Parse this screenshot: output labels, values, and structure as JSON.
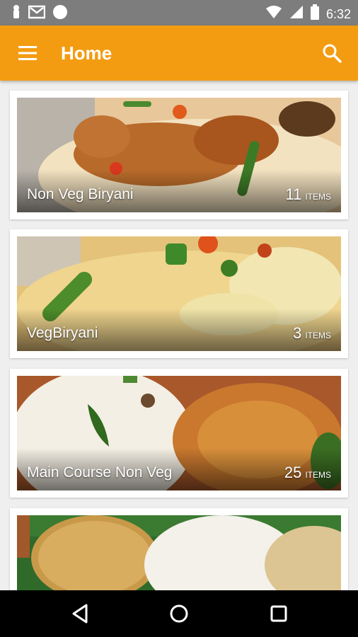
{
  "status_bar": {
    "time": "6:32",
    "icons": [
      "notification-icon",
      "gmail-icon",
      "circle-icon",
      "wifi-icon",
      "signal-icon",
      "battery-icon"
    ]
  },
  "app_bar": {
    "title": "Home",
    "menu_icon": "menu-icon",
    "search_icon": "search-icon",
    "color": "#f39c12"
  },
  "categories": [
    {
      "name": "Non Veg Biryani",
      "count": "11",
      "unit": "ITEMS"
    },
    {
      "name": "VegBiryani",
      "count": "3",
      "unit": "ITEMS"
    },
    {
      "name": "Main Course Non Veg",
      "count": "25",
      "unit": "ITEMS"
    },
    {
      "name": "",
      "count": "",
      "unit": ""
    }
  ],
  "nav_bar": {
    "icons": [
      "back-icon",
      "home-icon",
      "recents-icon"
    ]
  }
}
